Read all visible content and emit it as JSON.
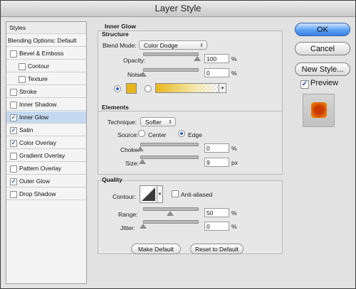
{
  "window": {
    "title": "Layer Style"
  },
  "styles_list": {
    "header": "Styles",
    "items": [
      {
        "label": "Blending Options: Default",
        "checkbox": false,
        "checked": false,
        "indent": 0,
        "selected": false
      },
      {
        "label": "Bevel & Emboss",
        "checkbox": true,
        "checked": false,
        "indent": 0,
        "selected": false
      },
      {
        "label": "Contour",
        "checkbox": true,
        "checked": false,
        "indent": 1,
        "selected": false
      },
      {
        "label": "Texture",
        "checkbox": true,
        "checked": false,
        "indent": 1,
        "selected": false
      },
      {
        "label": "Stroke",
        "checkbox": true,
        "checked": false,
        "indent": 0,
        "selected": false
      },
      {
        "label": "Inner Shadow",
        "checkbox": true,
        "checked": false,
        "indent": 0,
        "selected": false
      },
      {
        "label": "Inner Glow",
        "checkbox": true,
        "checked": true,
        "indent": 0,
        "selected": true
      },
      {
        "label": "Satin",
        "checkbox": true,
        "checked": true,
        "indent": 0,
        "selected": false
      },
      {
        "label": "Color Overlay",
        "checkbox": true,
        "checked": true,
        "indent": 0,
        "selected": false
      },
      {
        "label": "Gradient Overlay",
        "checkbox": true,
        "checked": false,
        "indent": 0,
        "selected": false
      },
      {
        "label": "Pattern Overlay",
        "checkbox": true,
        "checked": false,
        "indent": 0,
        "selected": false
      },
      {
        "label": "Outer Glow",
        "checkbox": true,
        "checked": true,
        "indent": 0,
        "selected": false
      },
      {
        "label": "Drop Shadow",
        "checkbox": true,
        "checked": false,
        "indent": 0,
        "selected": false
      }
    ]
  },
  "inner_glow": {
    "title": "Inner Glow",
    "structure": {
      "title": "Structure",
      "blend_mode_label": "Blend Mode:",
      "blend_mode_value": "Color Dodge",
      "opacity_label": "Opacity:",
      "opacity_value": "100",
      "opacity_unit": "%",
      "opacity_level": 1.0,
      "noise_label": "Noise:",
      "noise_value": "0",
      "noise_unit": "%",
      "noise_level": 0.0,
      "color_swatch": "#e8b61e",
      "gradient_colors": [
        "#e8b61e",
        "#f3e7a6"
      ],
      "fill_mode": "color"
    },
    "elements": {
      "title": "Elements",
      "technique_label": "Technique:",
      "technique_value": "Softer",
      "source_label": "Source:",
      "source_center": "Center",
      "source_edge": "Edge",
      "source_selected": "edge",
      "choke_label": "Choke:",
      "choke_value": "0",
      "choke_unit": "%",
      "choke_level": 0.0,
      "size_label": "Size:",
      "size_value": "9",
      "size_unit": "px",
      "size_level": 0.04
    },
    "quality": {
      "title": "Quality",
      "contour_label": "Contour:",
      "anti_aliased_label": "Anti-aliased",
      "anti_aliased": false,
      "range_label": "Range:",
      "range_value": "50",
      "range_unit": "%",
      "range_level": 0.5,
      "jitter_label": "Jitter:",
      "jitter_value": "0",
      "jitter_unit": "%",
      "jitter_level": 0.0
    },
    "make_default_label": "Make Default",
    "reset_default_label": "Reset to Default"
  },
  "actions": {
    "ok_label": "OK",
    "cancel_label": "Cancel",
    "new_style_label": "New Style...",
    "preview_label": "Preview",
    "preview_checked": true,
    "preview_colors": [
      "#c83a00",
      "#ff9a00"
    ]
  }
}
